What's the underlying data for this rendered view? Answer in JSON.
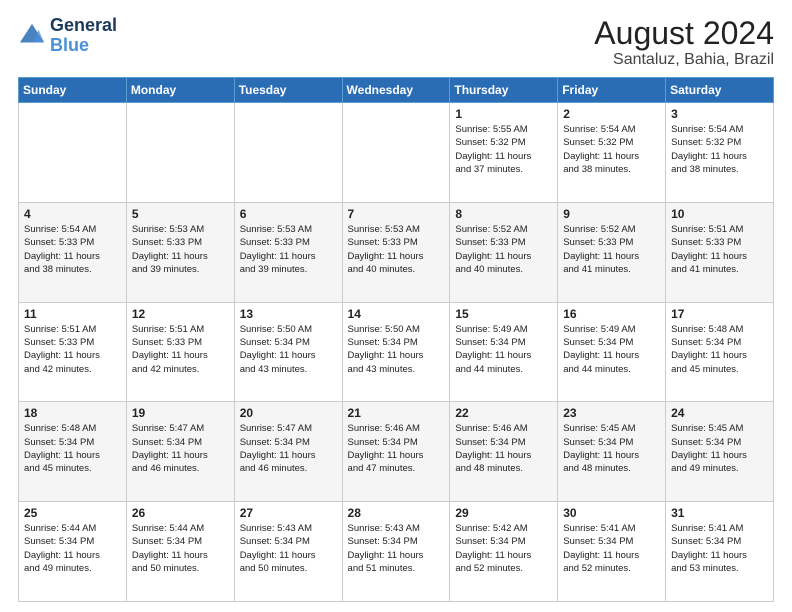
{
  "logo": {
    "line1": "General",
    "line2": "Blue"
  },
  "title": "August 2024",
  "subtitle": "Santaluz, Bahia, Brazil",
  "weekdays": [
    "Sunday",
    "Monday",
    "Tuesday",
    "Wednesday",
    "Thursday",
    "Friday",
    "Saturday"
  ],
  "weeks": [
    [
      {
        "day": "",
        "info": ""
      },
      {
        "day": "",
        "info": ""
      },
      {
        "day": "",
        "info": ""
      },
      {
        "day": "",
        "info": ""
      },
      {
        "day": "1",
        "info": "Sunrise: 5:55 AM\nSunset: 5:32 PM\nDaylight: 11 hours\nand 37 minutes."
      },
      {
        "day": "2",
        "info": "Sunrise: 5:54 AM\nSunset: 5:32 PM\nDaylight: 11 hours\nand 38 minutes."
      },
      {
        "day": "3",
        "info": "Sunrise: 5:54 AM\nSunset: 5:32 PM\nDaylight: 11 hours\nand 38 minutes."
      }
    ],
    [
      {
        "day": "4",
        "info": "Sunrise: 5:54 AM\nSunset: 5:33 PM\nDaylight: 11 hours\nand 38 minutes."
      },
      {
        "day": "5",
        "info": "Sunrise: 5:53 AM\nSunset: 5:33 PM\nDaylight: 11 hours\nand 39 minutes."
      },
      {
        "day": "6",
        "info": "Sunrise: 5:53 AM\nSunset: 5:33 PM\nDaylight: 11 hours\nand 39 minutes."
      },
      {
        "day": "7",
        "info": "Sunrise: 5:53 AM\nSunset: 5:33 PM\nDaylight: 11 hours\nand 40 minutes."
      },
      {
        "day": "8",
        "info": "Sunrise: 5:52 AM\nSunset: 5:33 PM\nDaylight: 11 hours\nand 40 minutes."
      },
      {
        "day": "9",
        "info": "Sunrise: 5:52 AM\nSunset: 5:33 PM\nDaylight: 11 hours\nand 41 minutes."
      },
      {
        "day": "10",
        "info": "Sunrise: 5:51 AM\nSunset: 5:33 PM\nDaylight: 11 hours\nand 41 minutes."
      }
    ],
    [
      {
        "day": "11",
        "info": "Sunrise: 5:51 AM\nSunset: 5:33 PM\nDaylight: 11 hours\nand 42 minutes."
      },
      {
        "day": "12",
        "info": "Sunrise: 5:51 AM\nSunset: 5:33 PM\nDaylight: 11 hours\nand 42 minutes."
      },
      {
        "day": "13",
        "info": "Sunrise: 5:50 AM\nSunset: 5:34 PM\nDaylight: 11 hours\nand 43 minutes."
      },
      {
        "day": "14",
        "info": "Sunrise: 5:50 AM\nSunset: 5:34 PM\nDaylight: 11 hours\nand 43 minutes."
      },
      {
        "day": "15",
        "info": "Sunrise: 5:49 AM\nSunset: 5:34 PM\nDaylight: 11 hours\nand 44 minutes."
      },
      {
        "day": "16",
        "info": "Sunrise: 5:49 AM\nSunset: 5:34 PM\nDaylight: 11 hours\nand 44 minutes."
      },
      {
        "day": "17",
        "info": "Sunrise: 5:48 AM\nSunset: 5:34 PM\nDaylight: 11 hours\nand 45 minutes."
      }
    ],
    [
      {
        "day": "18",
        "info": "Sunrise: 5:48 AM\nSunset: 5:34 PM\nDaylight: 11 hours\nand 45 minutes."
      },
      {
        "day": "19",
        "info": "Sunrise: 5:47 AM\nSunset: 5:34 PM\nDaylight: 11 hours\nand 46 minutes."
      },
      {
        "day": "20",
        "info": "Sunrise: 5:47 AM\nSunset: 5:34 PM\nDaylight: 11 hours\nand 46 minutes."
      },
      {
        "day": "21",
        "info": "Sunrise: 5:46 AM\nSunset: 5:34 PM\nDaylight: 11 hours\nand 47 minutes."
      },
      {
        "day": "22",
        "info": "Sunrise: 5:46 AM\nSunset: 5:34 PM\nDaylight: 11 hours\nand 48 minutes."
      },
      {
        "day": "23",
        "info": "Sunrise: 5:45 AM\nSunset: 5:34 PM\nDaylight: 11 hours\nand 48 minutes."
      },
      {
        "day": "24",
        "info": "Sunrise: 5:45 AM\nSunset: 5:34 PM\nDaylight: 11 hours\nand 49 minutes."
      }
    ],
    [
      {
        "day": "25",
        "info": "Sunrise: 5:44 AM\nSunset: 5:34 PM\nDaylight: 11 hours\nand 49 minutes."
      },
      {
        "day": "26",
        "info": "Sunrise: 5:44 AM\nSunset: 5:34 PM\nDaylight: 11 hours\nand 50 minutes."
      },
      {
        "day": "27",
        "info": "Sunrise: 5:43 AM\nSunset: 5:34 PM\nDaylight: 11 hours\nand 50 minutes."
      },
      {
        "day": "28",
        "info": "Sunrise: 5:43 AM\nSunset: 5:34 PM\nDaylight: 11 hours\nand 51 minutes."
      },
      {
        "day": "29",
        "info": "Sunrise: 5:42 AM\nSunset: 5:34 PM\nDaylight: 11 hours\nand 52 minutes."
      },
      {
        "day": "30",
        "info": "Sunrise: 5:41 AM\nSunset: 5:34 PM\nDaylight: 11 hours\nand 52 minutes."
      },
      {
        "day": "31",
        "info": "Sunrise: 5:41 AM\nSunset: 5:34 PM\nDaylight: 11 hours\nand 53 minutes."
      }
    ]
  ]
}
